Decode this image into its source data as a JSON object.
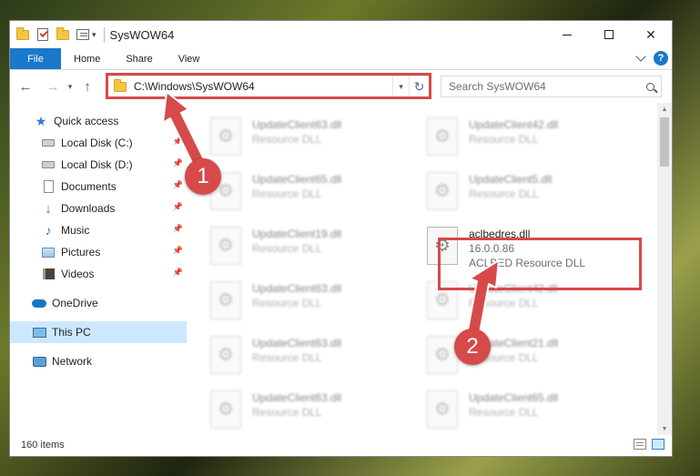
{
  "window": {
    "title": "SysWOW64",
    "controls": {
      "minimize": "minimize",
      "maximize": "maximize",
      "close": "✕"
    }
  },
  "ribbon": {
    "tabs": [
      {
        "label": "File"
      },
      {
        "label": "Home"
      },
      {
        "label": "Share"
      },
      {
        "label": "View"
      }
    ],
    "help": "?"
  },
  "nav": {
    "address": "C:\\Windows\\SysWOW64",
    "search_placeholder": "Search SysWOW64"
  },
  "sidebar": {
    "quick_access": "Quick access",
    "items": [
      {
        "label": "Local Disk (C:)",
        "icon": "drive-icon"
      },
      {
        "label": "Local Disk (D:)",
        "icon": "drive-icon"
      },
      {
        "label": "Documents",
        "icon": "documents-icon"
      },
      {
        "label": "Downloads",
        "icon": "downloads-icon"
      },
      {
        "label": "Music",
        "icon": "music-icon"
      },
      {
        "label": "Pictures",
        "icon": "pictures-icon"
      },
      {
        "label": "Videos",
        "icon": "videos-icon"
      }
    ],
    "onedrive": "OneDrive",
    "this_pc": "This PC",
    "network": "Network"
  },
  "files": [
    {
      "name": "UpdateClient63.dll",
      "type": "Resource DLL"
    },
    {
      "name": "UpdateClient42.dll",
      "type": "Resource DLL"
    },
    {
      "name": "UpdateClient65.dll",
      "type": "Resource DLL"
    },
    {
      "name": "UpdateClient5.dll",
      "type": "Resource DLL"
    },
    {
      "name": "UpdateClient19.dll",
      "type": "Resource DLL"
    },
    {
      "name": "aclbedres.dll",
      "version": "16.0.0.86",
      "type": "ACLBED Resource DLL"
    },
    {
      "name": "UpdateClient63.dll",
      "type": "Resource DLL"
    },
    {
      "name": "UpdateClient42.dll",
      "type": "Resource DLL"
    },
    {
      "name": "UpdateClient63.dll",
      "type": "Resource DLL"
    },
    {
      "name": "UpdateClient21.dll",
      "type": "Resource DLL"
    },
    {
      "name": "UpdateClient63.dll",
      "type": "Resource DLL"
    },
    {
      "name": "UpdateClient65.dll",
      "type": "Resource DLL"
    }
  ],
  "status": {
    "count": "160 items"
  },
  "annotations": {
    "step1": "1",
    "step2": "2",
    "color": "#d64a4a"
  }
}
